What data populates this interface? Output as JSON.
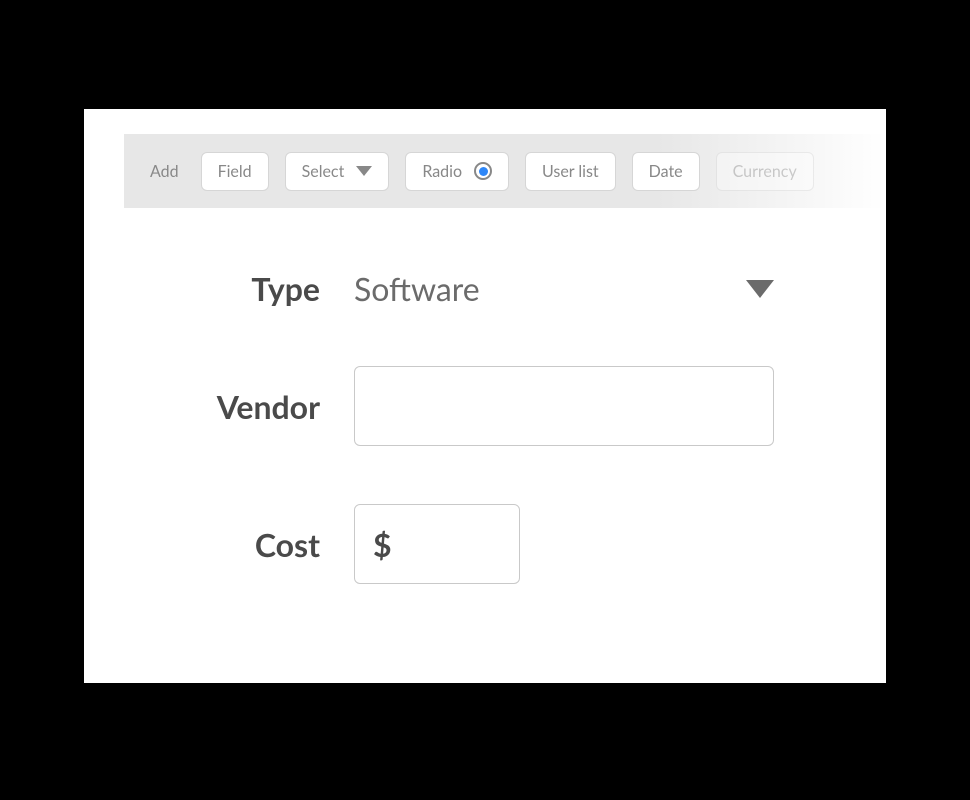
{
  "toolbar": {
    "label": "Add",
    "items": [
      {
        "label": "Field"
      },
      {
        "label": "Select"
      },
      {
        "label": "Radio"
      },
      {
        "label": "User list"
      },
      {
        "label": "Date"
      },
      {
        "label": "Currency"
      }
    ]
  },
  "form": {
    "type": {
      "label": "Type",
      "value": "Software"
    },
    "vendor": {
      "label": "Vendor",
      "value": ""
    },
    "cost": {
      "label": "Cost",
      "symbol": "$",
      "value": ""
    }
  }
}
